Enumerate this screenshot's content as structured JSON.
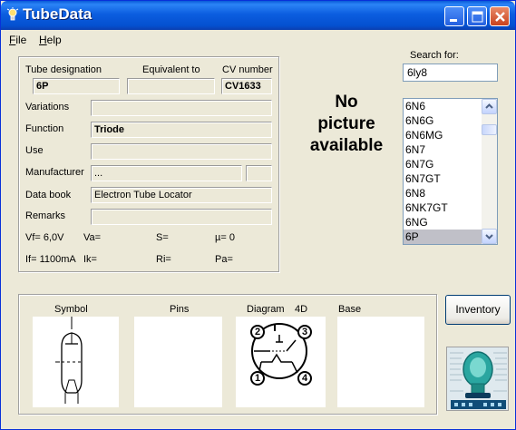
{
  "window": {
    "title": "TubeData"
  },
  "menu": [
    {
      "label": "File",
      "accel": "F",
      "rest": "ile"
    },
    {
      "label": "Help",
      "accel": "H",
      "rest": "elp"
    }
  ],
  "details": {
    "tube_designation": {
      "label": "Tube designation",
      "value": "6P"
    },
    "equivalent_to": {
      "label": "Equivalent to",
      "value": ""
    },
    "cv_number": {
      "label": "CV number",
      "value": "CV1633"
    },
    "variations": {
      "label": "Variations",
      "value": ""
    },
    "function": {
      "label": "Function",
      "value": "Triode"
    },
    "use": {
      "label": "Use",
      "value": ""
    },
    "manufacturer": {
      "label": "Manufacturer",
      "value": "...",
      "extra": ""
    },
    "data_book": {
      "label": "Data book",
      "value": "Electron Tube Locator"
    },
    "remarks": {
      "label": "Remarks",
      "value": ""
    },
    "params": {
      "vf": "Vf= 6,0V",
      "va": "Va=",
      "s": "S=",
      "mu": "µ=   0",
      "if": "If= 1100mA",
      "ik": "Ik=",
      "ri": "Ri=",
      "pa": "Pa="
    }
  },
  "no_picture": [
    "No",
    "picture",
    "available"
  ],
  "search": {
    "label": "Search for:",
    "value": "6ly8"
  },
  "tube_list": {
    "items": [
      "6N6",
      "6N6G",
      "6N6MG",
      "6N7",
      "6N7G",
      "6N7GT",
      "6N8",
      "6NK7GT",
      "6NG",
      "6P"
    ],
    "selected": "6P"
  },
  "bottom": {
    "symbol_label": "Symbol",
    "pins_label": "Pins",
    "diagram_label": "Diagram",
    "diagram_code": "4D",
    "base_label": "Base",
    "pin_numbers": [
      "1",
      "2",
      "3",
      "4"
    ]
  },
  "inventory_button": "Inventory",
  "colors": {
    "title_blue": "#0450d0",
    "window_bg": "#ece9d8",
    "selection": "#c0c0c8"
  }
}
